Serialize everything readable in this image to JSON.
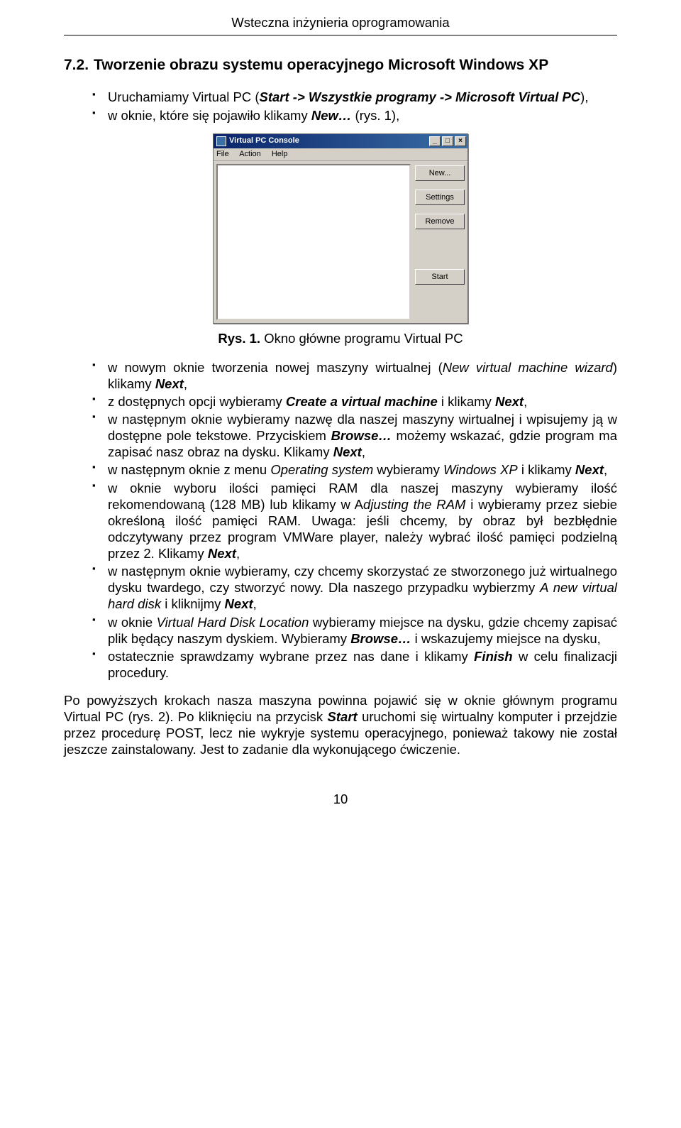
{
  "header": {
    "title": "Wsteczna inżynieria oprogramowania"
  },
  "section": {
    "number": "7.2.",
    "title": "Tworzenie obrazu systemu operacyjnego Microsoft Windows XP"
  },
  "intro_bullets": [
    {
      "pre": "Uruchamiamy Virtual PC (",
      "bi1": "Start -> Wszystkie programy -> Microsoft Virtual PC",
      "post": "),"
    },
    {
      "pre": "w oknie, które się pojawiło klikamy ",
      "bi1": "New…",
      "post": " (rys. 1),"
    }
  ],
  "figure": {
    "window": {
      "title": "Virtual PC Console",
      "minimize": "_",
      "maximize": "□",
      "close": "×",
      "menu": [
        "File",
        "Action",
        "Help"
      ],
      "buttons": [
        "New...",
        "Settings",
        "Remove",
        "Start"
      ]
    },
    "caption_pre": "Rys. 1. ",
    "caption": "Okno główne programu Virtual PC"
  },
  "main_bullets": [
    {
      "parts": [
        {
          "t": "w nowym oknie tworzenia nowej maszyny wirtualnej ("
        },
        {
          "i": "New virtual machine wizard"
        },
        {
          "t": ") klikamy "
        },
        {
          "bi": "Next"
        },
        {
          "t": ","
        }
      ]
    },
    {
      "parts": [
        {
          "t": "z dostępnych opcji wybieramy "
        },
        {
          "bi": "Create a virtual machine"
        },
        {
          "t": " i klikamy "
        },
        {
          "bi": "Next"
        },
        {
          "t": ","
        }
      ]
    },
    {
      "parts": [
        {
          "t": "w następnym oknie wybieramy nazwę dla naszej maszyny wirtualnej i wpisujemy ją w dostępne pole tekstowe. Przyciskiem "
        },
        {
          "bi": "Browse…"
        },
        {
          "t": " możemy wskazać, gdzie program ma zapisać nasz obraz na dysku. Klikamy "
        },
        {
          "bi": "Next"
        },
        {
          "t": ","
        }
      ]
    },
    {
      "parts": [
        {
          "t": "w następnym oknie z menu "
        },
        {
          "i": "Operating system"
        },
        {
          "t": " wybieramy "
        },
        {
          "i": "Windows XP"
        },
        {
          "t": " i klikamy "
        },
        {
          "bi": "Next"
        },
        {
          "t": ","
        }
      ]
    },
    {
      "parts": [
        {
          "t": "w oknie wyboru ilości pamięci RAM dla naszej maszyny wybieramy ilość rekomendowaną (128 MB) lub klikamy w A"
        },
        {
          "i": "djusting the RAM"
        },
        {
          "t": " i wybieramy przez siebie określoną ilość pamięci RAM. Uwaga: jeśli chcemy, by obraz był bezbłędnie odczytywany przez program VMWare player, należy wybrać ilość pamięci podzielną przez 2. Klikamy "
        },
        {
          "bi": "Next"
        },
        {
          "t": ","
        }
      ]
    },
    {
      "parts": [
        {
          "t": "w następnym oknie wybieramy, czy chcemy skorzystać ze stworzonego już wirtualnego dysku twardego, czy stworzyć nowy. Dla naszego przypadku wybierzmy "
        },
        {
          "i": "A new virtual hard disk"
        },
        {
          "t": " i kliknijmy "
        },
        {
          "bi": "Next"
        },
        {
          "t": ","
        }
      ]
    },
    {
      "parts": [
        {
          "t": "w oknie "
        },
        {
          "i": "Virtual Hard Disk Location"
        },
        {
          "t": " wybieramy miejsce na dysku, gdzie chcemy zapisać plik będący naszym dyskiem. Wybieramy "
        },
        {
          "bi": "Browse…"
        },
        {
          "t": " i wskazujemy miejsce na dysku,"
        }
      ]
    },
    {
      "parts": [
        {
          "t": "ostatecznie sprawdzamy wybrane przez nas dane i klikamy "
        },
        {
          "bi": "Finish"
        },
        {
          "t": " w celu finalizacji procedury."
        }
      ]
    }
  ],
  "closing_para": {
    "parts": [
      {
        "t": "Po powyższych krokach nasza maszyna powinna pojawić się w oknie głównym programu Virtual PC (rys. 2). Po kliknięciu na przycisk "
      },
      {
        "bi": "Start"
      },
      {
        "t": " uruchomi się wirtualny komputer i przejdzie przez procedurę POST, lecz nie wykryje systemu operacyjnego, ponieważ takowy nie został jeszcze zainstalowany. Jest to zadanie dla wykonującego ćwiczenie."
      }
    ]
  },
  "page_number": "10"
}
